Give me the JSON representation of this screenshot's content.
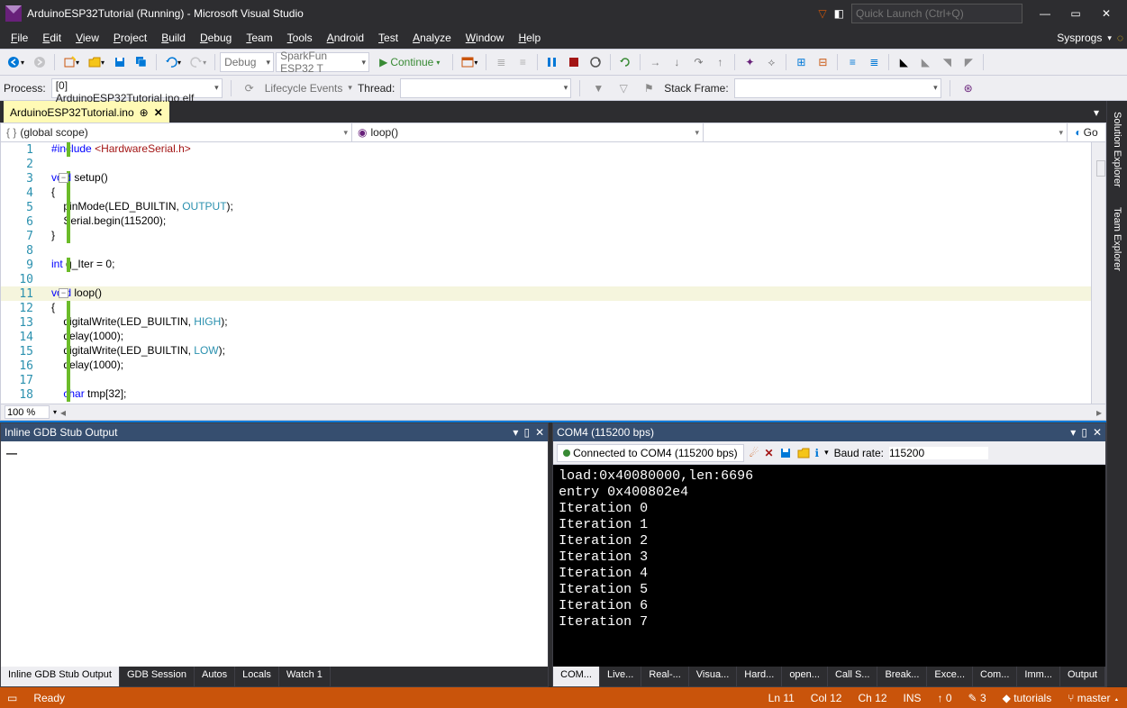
{
  "titlebar": {
    "title": "ArduinoESP32Tutorial (Running) - Microsoft Visual Studio",
    "quick_launch_placeholder": "Quick Launch (Ctrl+Q)"
  },
  "menus": [
    "File",
    "Edit",
    "View",
    "Project",
    "Build",
    "Debug",
    "Team",
    "Tools",
    "Android",
    "Test",
    "Analyze",
    "Window",
    "Help"
  ],
  "brand": "Sysprogs",
  "toolbar": {
    "config": "Debug",
    "target": "SparkFun ESP32 T",
    "continue": "Continue"
  },
  "debugbar": {
    "process_label": "Process:",
    "process": "[0] ArduinoESP32Tutorial.ino.elf",
    "lifecycle": "Lifecycle Events",
    "thread_label": "Thread:",
    "stack_label": "Stack Frame:"
  },
  "doc_tab": {
    "name": "ArduinoESP32Tutorial.ino"
  },
  "nav": {
    "scope": "(global scope)",
    "member": "loop()",
    "go": "Go"
  },
  "code": {
    "l1": "#include <HardwareSerial.h>",
    "l3a": "void",
    "l3b": " setup()",
    "l4": "{",
    "l5a": "    pinMode(LED_BUILTIN, ",
    "l5b": "OUTPUT",
    "l5c": ");",
    "l6": "    Serial.begin(115200);",
    "l7": "}",
    "l9a": "int",
    "l9b": " g_Iter = 0;",
    "l11a": "void",
    "l11b": " loop()",
    "l12": "{",
    "l13a": "    digitalWrite(LED_BUILTIN, ",
    "l13b": "HIGH",
    "l13c": ");",
    "l14": "    delay(1000);",
    "l15a": "    digitalWrite(LED_BUILTIN, ",
    "l15b": "LOW",
    "l15c": ");",
    "l16": "    delay(1000);",
    "l18a": "    ",
    "l18b": "char",
    "l18c": " tmp[32];"
  },
  "zoom": "100 %",
  "panel_left": {
    "title": "Inline GDB Stub Output",
    "prompt": "—",
    "tabs": [
      "Inline GDB Stub Output",
      "GDB Session",
      "Autos",
      "Locals",
      "Watch 1"
    ]
  },
  "panel_right": {
    "title": "COM4 (115200 bps)",
    "status": "Connected to COM4 (115200 bps)",
    "baud_label": "Baud rate:",
    "baud": "115200",
    "lines": [
      "load:0x40080000,len:6696",
      "entry 0x400802e4",
      "Iteration 0",
      "Iteration 1",
      "Iteration 2",
      "Iteration 3",
      "Iteration 4",
      "Iteration 5",
      "Iteration 6",
      "Iteration 7"
    ],
    "tabs": [
      "COM...",
      "Live...",
      "Real-...",
      "Visua...",
      "Hard...",
      "open...",
      "Call S...",
      "Break...",
      "Exce...",
      "Com...",
      "Imm...",
      "Output"
    ]
  },
  "status": {
    "ready": "Ready",
    "ln": "Ln 11",
    "col": "Col 12",
    "ch": "Ch 12",
    "ins": "INS",
    "up": "0",
    "pen": "3",
    "repo": "tutorials",
    "branch": "master"
  }
}
